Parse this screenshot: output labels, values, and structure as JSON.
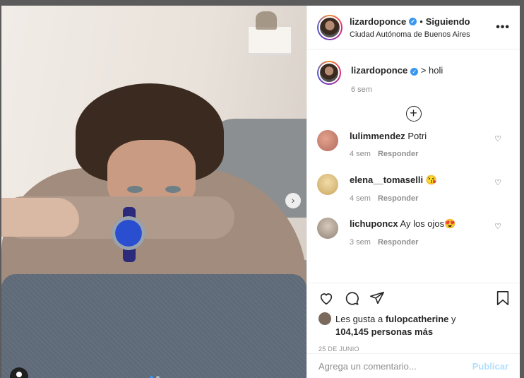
{
  "post": {
    "author": "lizardoponce",
    "follow_status": "Siguiendo",
    "dot": "•",
    "location": "Ciudad Autónoma de Buenos Aires",
    "caption_user": "lizardoponce",
    "caption_text": "> holi",
    "caption_time": "6 sem",
    "load_more_icon": "plus-circle-icon",
    "comments": [
      {
        "user": "lulimmendez",
        "text": "Potri",
        "time": "4 sem",
        "reply": "Responder",
        "avatar_color": "#c98d7a"
      },
      {
        "user": "elena__tomaselli",
        "text": "😘",
        "time": "4 sem",
        "reply": "Responder",
        "avatar_color": "#e9c98a"
      },
      {
        "user": "lichuponcx",
        "text": "Ay los ojos😍",
        "time": "3 sem",
        "reply": "Responder",
        "avatar_color": "#b8a99a"
      }
    ],
    "likes_prefix": "Les gusta a",
    "likes_user": "fulopcatherine",
    "likes_and": "y",
    "likes_count": "104,145",
    "likes_suffix": "personas más",
    "date": "25 DE JUNIO",
    "add_comment_placeholder": "Agrega un comentario...",
    "post_button": "Publicar"
  },
  "colors": {
    "accent": "#3897f0",
    "disabled_post": "#b2dffc"
  }
}
